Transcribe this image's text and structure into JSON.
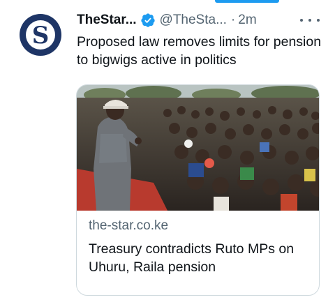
{
  "tweet": {
    "author_name": "TheStar...",
    "handle": "@TheSta...",
    "separator": "·",
    "time": "2m",
    "text": "Proposed law removes limits for pension to bigwigs active in politics",
    "avatar_letter": "S"
  },
  "card": {
    "domain": "the-star.co.ke",
    "title": "Treasury contradicts Ruto MPs on Uhuru, Raila pension"
  },
  "colors": {
    "accent": "#1d9bf0",
    "brand": "#1e3566",
    "muted_text": "#536471",
    "border": "#cfd9de"
  },
  "icons": {
    "verified": "verified-badge-icon",
    "more": "more-options-icon"
  }
}
